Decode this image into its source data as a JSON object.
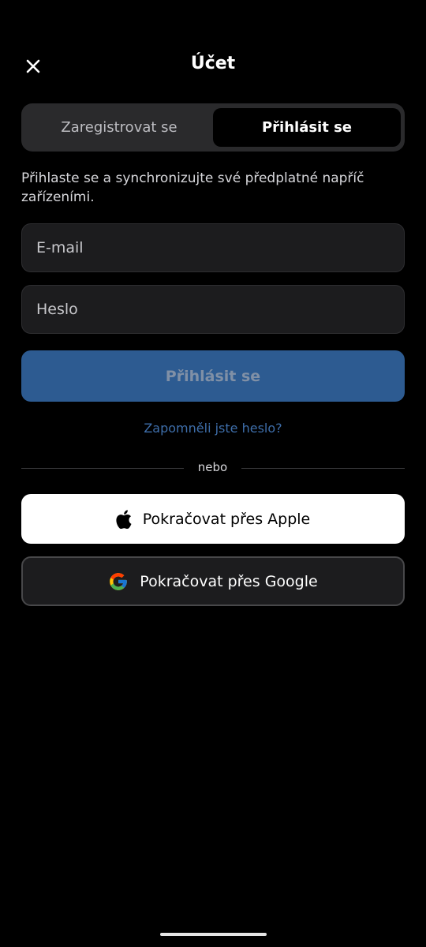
{
  "header": {
    "title": "Účet",
    "close_icon": "close-icon"
  },
  "tabs": [
    {
      "label": "Zaregistrovat se",
      "selected": false
    },
    {
      "label": "Přihlásit se",
      "selected": true
    }
  ],
  "description": "Přihlaste se a synchronizujte své předplatné napříč zařízeními.",
  "form": {
    "email_placeholder": "E-mail",
    "email_value": "",
    "password_placeholder": "Heslo",
    "password_value": ""
  },
  "buttons": {
    "submit_label": "Přihlásit se",
    "forgot_label": "Zapomněli jste heslo?",
    "divider_label": "nebo",
    "apple_label": "Pokračovat přes Apple",
    "google_label": "Pokračovat přes Google"
  },
  "colors": {
    "background": "#000000",
    "accent": "#2d5b91",
    "link": "#3e6eaa",
    "field_background": "#1c1c1e"
  },
  "icons": {
    "apple": "apple-logo-icon",
    "google": "google-logo-icon"
  }
}
